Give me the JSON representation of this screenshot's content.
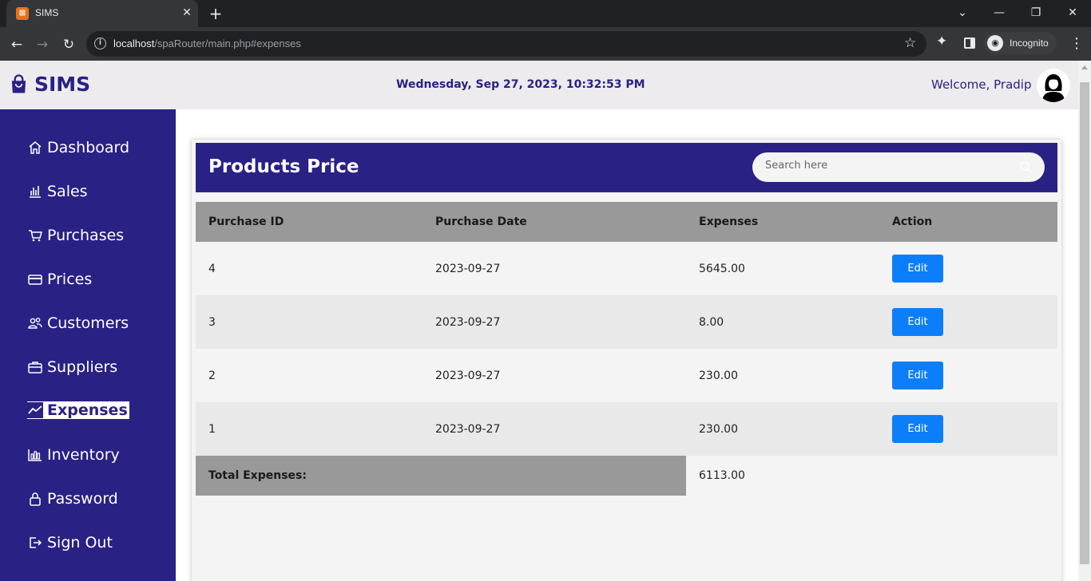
{
  "browser": {
    "tab_title": "SIMS",
    "url_host": "localhost",
    "url_path": "/spaRouter/main.php#expenses",
    "profile_label": "Incognito"
  },
  "header": {
    "brand": "SIMS",
    "datetime": "Wednesday, Sep 27, 2023, 10:32:53 PM",
    "welcome": "Welcome, Pradip"
  },
  "sidebar": {
    "items": [
      {
        "label": "Dashboard",
        "icon": "home-icon"
      },
      {
        "label": "Sales",
        "icon": "bar-chart-icon"
      },
      {
        "label": "Purchases",
        "icon": "cart-icon"
      },
      {
        "label": "Prices",
        "icon": "card-icon"
      },
      {
        "label": "Customers",
        "icon": "people-icon"
      },
      {
        "label": "Suppliers",
        "icon": "briefcase-icon"
      },
      {
        "label": "Expenses",
        "icon": "trend-icon",
        "active": true
      },
      {
        "label": "Inventory",
        "icon": "inventory-icon"
      },
      {
        "label": "Password",
        "icon": "lock-icon"
      },
      {
        "label": "Sign Out",
        "icon": "sign-out-icon"
      }
    ]
  },
  "card": {
    "title": "Products Price",
    "search_placeholder": "Search here"
  },
  "table": {
    "columns": [
      "Purchase ID",
      "Purchase Date",
      "Expenses",
      "Action"
    ],
    "rows": [
      {
        "id": "4",
        "date": "2023-09-27",
        "expenses": "5645.00",
        "action": "Edit"
      },
      {
        "id": "3",
        "date": "2023-09-27",
        "expenses": "8.00",
        "action": "Edit"
      },
      {
        "id": "2",
        "date": "2023-09-27",
        "expenses": "230.00",
        "action": "Edit"
      },
      {
        "id": "1",
        "date": "2023-09-27",
        "expenses": "230.00",
        "action": "Edit"
      }
    ],
    "total_label": "Total Expenses:",
    "total_value": "6113.00"
  },
  "colors": {
    "brand": "#2a2185",
    "button": "#0d7ef9",
    "header_row": "#999999"
  }
}
